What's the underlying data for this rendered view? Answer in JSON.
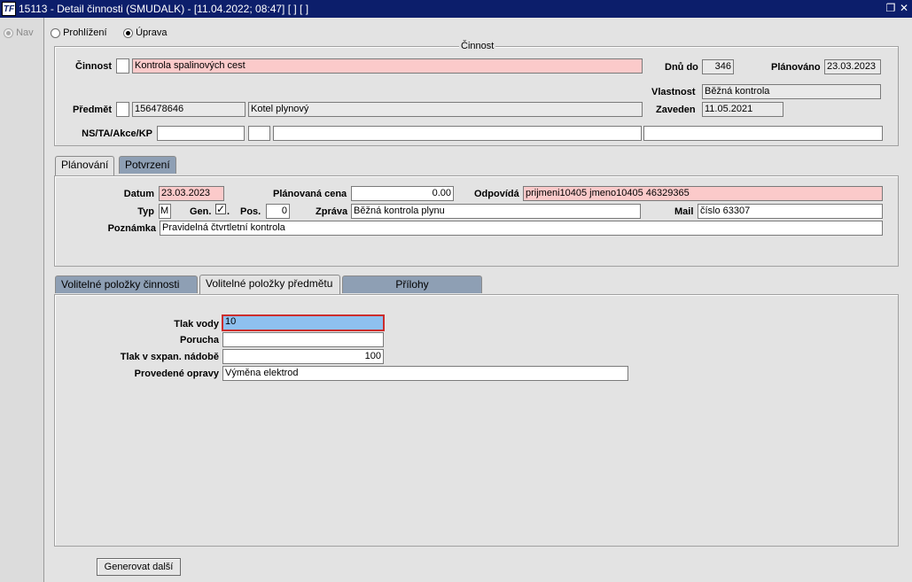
{
  "window": {
    "title": "15113 - Detail činnosti (SMUDALK) - [11.04.2022; 08:47] [ ] [ ]",
    "logo": "TF"
  },
  "nav": {
    "label": "Nav"
  },
  "mode": {
    "browse_label": "Prohlížení",
    "edit_label": "Úprava",
    "selected": "edit"
  },
  "activity_frame": {
    "title": "Činnost",
    "cinnost_label": "Činnost",
    "cinnost_value": "Kontrola spalinových cest",
    "dnu_do_label": "Dnů do",
    "dnu_do_value": "346",
    "planovano_label": "Plánováno",
    "planovano_value": "23.03.2023",
    "vlastnost_label": "Vlastnost",
    "vlastnost_value": "Běžná kontrola",
    "predmet_label": "Předmět",
    "predmet_code": "156478646",
    "predmet_name": "Kotel plynový",
    "zaveden_label": "Zaveden",
    "zaveden_value": "11.05.2021",
    "ns_label": "NS/TA/Akce/KP"
  },
  "tabs_top": [
    {
      "label": "Plánování",
      "active": true
    },
    {
      "label": "Potvrzení",
      "active": false
    }
  ],
  "planning": {
    "datum_label": "Datum",
    "datum_value": "23.03.2023",
    "cena_label": "Plánovaná cena",
    "cena_value": "0.00",
    "odpovida_label": "Odpovídá",
    "odpovida_value": "prijmeni10405 jmeno10405 46329365",
    "typ_label": "Typ",
    "typ_value": "M",
    "gen_label": "Gen.",
    "gen_checked": "✓",
    "pos_label": "Pos.",
    "pos_value": "0",
    "zprava_label": "Zpráva",
    "zprava_value": "Běžná kontrola plynu",
    "mail_label": "Mail",
    "mail_value": "číslo 63307",
    "poznamka_label": "Poznámka",
    "poznamka_value": "Pravidelná čtvrtletní kontrola"
  },
  "tabs_bottom": [
    {
      "label": "Volitelné položky činnosti",
      "active": false
    },
    {
      "label": "Volitelné položky předmětu",
      "active": true
    },
    {
      "label": "Přílohy",
      "active": false
    }
  ],
  "optional": {
    "tlak_vody_label": "Tlak vody",
    "tlak_vody_value": "10",
    "porucha_label": "Porucha",
    "porucha_value": "",
    "tlak_nadobe_label": "Tlak v sxpan. nádobě",
    "tlak_nadobe_value": "100",
    "opravy_label": "Provedené opravy",
    "opravy_value": "Výměna elektrod"
  },
  "footer": {
    "generate_label": "Generovat další"
  },
  "colors": {
    "titlebar": "#0c1e6b",
    "required_field": "#fbcaca",
    "selected_field": "#8ec0ef",
    "inactive_tab": "#8e9fb4"
  }
}
